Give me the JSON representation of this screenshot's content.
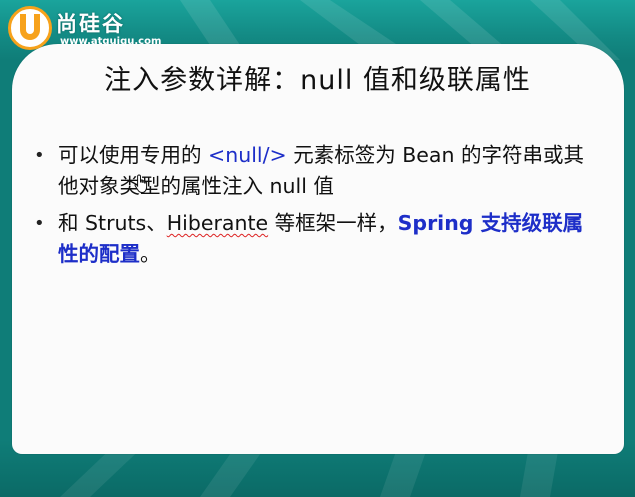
{
  "logo": {
    "name": "尚硅谷",
    "url": "www.atguigu.com"
  },
  "title": "注入参数详解：null 值和级联属性",
  "bullets": [
    {
      "segments": [
        "可以使用专用的 ",
        "<null/>",
        " 元素标签为 Bean 的字符串或其他对象类型的属性注入 null 值"
      ]
    },
    {
      "segments": [
        "和 Struts、",
        "Hiberante",
        " 等框架一样，",
        "Spring 支持级联属性的配置",
        "。"
      ]
    }
  ],
  "bullet_symbol": "•",
  "colors": {
    "background": "#0f7d78",
    "slide": "#fbfbfb",
    "accent_orange": "#f7a21b",
    "highlight_blue": "#1d2ec8"
  },
  "icons": {
    "cursor": "hand-pointer-icon"
  }
}
